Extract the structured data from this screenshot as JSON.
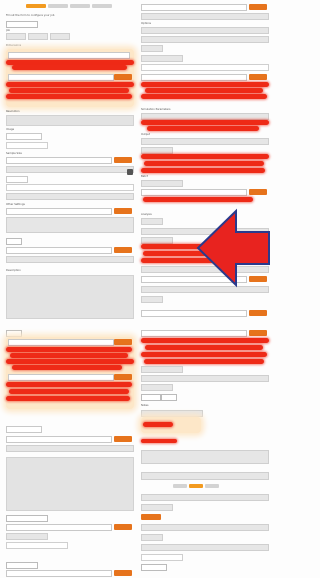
{
  "tabs": [
    {
      "label": "",
      "active": true
    },
    {
      "label": "",
      "active": false
    },
    {
      "label": "",
      "active": false
    },
    {
      "label": "",
      "active": false
    }
  ],
  "left_column": {
    "header_text": "Fill out the form to configure your job",
    "labels": {
      "section_a": "Job",
      "section_b": "Dimensions",
      "section_c": "Resolution",
      "section_d": "Image",
      "section_e": "Sample Size",
      "section_f": "Other Settings",
      "section_g": "Description"
    },
    "apply_button": "Apply",
    "add_button": "Add"
  },
  "right_column": {
    "labels": {
      "section_a": "Options",
      "section_b": "Simulation Parameters",
      "section_c": "Output",
      "section_d": "Batch",
      "section_e": "Analysis",
      "section_f": "Notes"
    },
    "submit_button": "Submit",
    "preview_button": "Preview"
  },
  "annotation": {
    "arrow_color": "#e8231f",
    "arrow_outline_color": "#2a3a8c",
    "scribble_color": "#ee2a17",
    "glow_color": "#fde7c8"
  },
  "accent_color": "#e6731c"
}
